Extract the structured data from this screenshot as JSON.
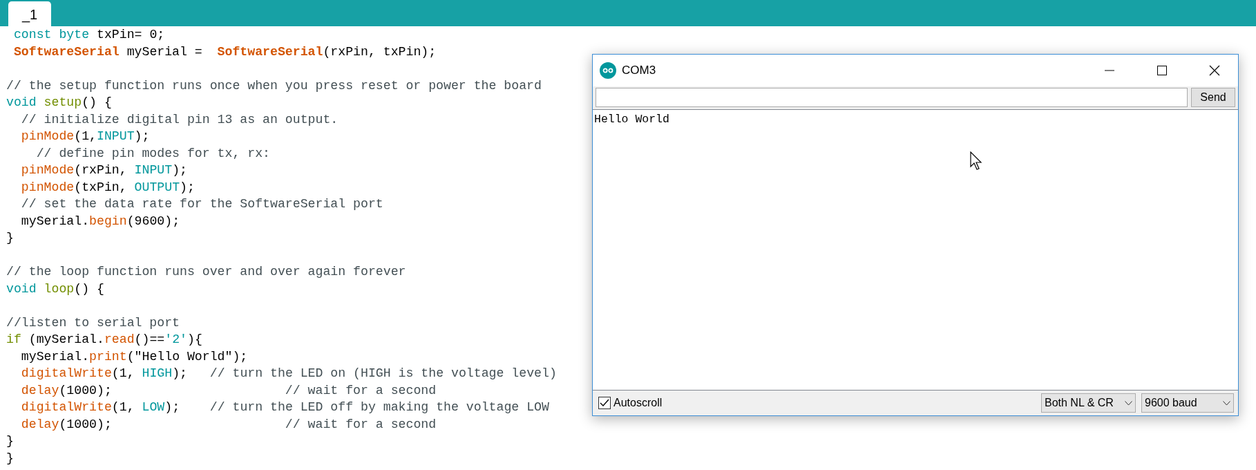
{
  "tabs": [
    {
      "label": "_1",
      "selected": true
    }
  ],
  "code": {
    "lines": [
      {
        "kind": "code",
        "tokens": [
          {
            "kind": "keyword",
            "text": " const"
          },
          {
            "kind": "keyword",
            "text": " byte"
          },
          {
            "kind": "plain",
            "text": " txPin= 0;"
          }
        ]
      },
      {
        "kind": "code",
        "tokens": [
          {
            "kind": "class",
            "text": " SoftwareSerial"
          },
          {
            "kind": "plain",
            "text": " mySerial =  "
          },
          {
            "kind": "class",
            "text": "SoftwareSerial"
          },
          {
            "kind": "plain",
            "text": "(rxPin, txPin);"
          }
        ]
      },
      {
        "kind": "blank"
      },
      {
        "kind": "code",
        "tokens": [
          {
            "kind": "comment",
            "text": "// the setup function runs once when you press reset or power the board"
          }
        ]
      },
      {
        "kind": "code",
        "tokens": [
          {
            "kind": "keyword",
            "text": "void "
          },
          {
            "kind": "control",
            "text": "setup"
          },
          {
            "kind": "plain",
            "text": "() {"
          }
        ]
      },
      {
        "kind": "code",
        "tokens": [
          {
            "kind": "comment",
            "text": "  // initialize digital pin 13 as an output."
          }
        ]
      },
      {
        "kind": "code",
        "tokens": [
          {
            "kind": "function",
            "text": "  pinMode"
          },
          {
            "kind": "plain",
            "text": "(1,"
          },
          {
            "kind": "keyword",
            "text": "INPUT"
          },
          {
            "kind": "plain",
            "text": ");"
          }
        ]
      },
      {
        "kind": "code",
        "tokens": [
          {
            "kind": "comment",
            "text": "    // define pin modes for tx, rx:"
          }
        ]
      },
      {
        "kind": "code",
        "tokens": [
          {
            "kind": "function",
            "text": "  pinMode"
          },
          {
            "kind": "plain",
            "text": "(rxPin, "
          },
          {
            "kind": "keyword",
            "text": "INPUT"
          },
          {
            "kind": "plain",
            "text": ");"
          }
        ]
      },
      {
        "kind": "code",
        "tokens": [
          {
            "kind": "function",
            "text": "  pinMode"
          },
          {
            "kind": "plain",
            "text": "(txPin, "
          },
          {
            "kind": "keyword",
            "text": "OUTPUT"
          },
          {
            "kind": "plain",
            "text": ");"
          }
        ]
      },
      {
        "kind": "code",
        "tokens": [
          {
            "kind": "comment",
            "text": "  // set the data rate for the SoftwareSerial port"
          }
        ]
      },
      {
        "kind": "code",
        "tokens": [
          {
            "kind": "plain",
            "text": "  mySerial."
          },
          {
            "kind": "function",
            "text": "begin"
          },
          {
            "kind": "plain",
            "text": "(9600);"
          }
        ]
      },
      {
        "kind": "code",
        "tokens": [
          {
            "kind": "plain",
            "text": "}"
          }
        ]
      },
      {
        "kind": "blank"
      },
      {
        "kind": "code",
        "tokens": [
          {
            "kind": "comment",
            "text": "// the loop function runs over and over again forever"
          }
        ]
      },
      {
        "kind": "code",
        "tokens": [
          {
            "kind": "keyword",
            "text": "void "
          },
          {
            "kind": "control",
            "text": "loop"
          },
          {
            "kind": "plain",
            "text": "() {"
          }
        ]
      },
      {
        "kind": "blank"
      },
      {
        "kind": "code",
        "tokens": [
          {
            "kind": "comment",
            "text": "//listen to serial port"
          }
        ]
      },
      {
        "kind": "code",
        "tokens": [
          {
            "kind": "control",
            "text": "if"
          },
          {
            "kind": "plain",
            "text": " (mySerial."
          },
          {
            "kind": "function",
            "text": "read"
          },
          {
            "kind": "plain",
            "text": "()=="
          },
          {
            "kind": "keyword",
            "text": "'2'"
          },
          {
            "kind": "plain",
            "text": "){"
          }
        ]
      },
      {
        "kind": "code",
        "tokens": [
          {
            "kind": "plain",
            "text": "  mySerial."
          },
          {
            "kind": "function",
            "text": "print"
          },
          {
            "kind": "plain",
            "text": "(\"Hello World\");"
          }
        ]
      },
      {
        "kind": "code",
        "tokens": [
          {
            "kind": "function",
            "text": "  digitalWrite"
          },
          {
            "kind": "plain",
            "text": "(1, "
          },
          {
            "kind": "keyword",
            "text": "HIGH"
          },
          {
            "kind": "plain",
            "text": ");   "
          },
          {
            "kind": "comment",
            "text": "// turn the LED on (HIGH is the voltage level)"
          }
        ]
      },
      {
        "kind": "code",
        "tokens": [
          {
            "kind": "function",
            "text": "  delay"
          },
          {
            "kind": "plain",
            "text": "(1000);                       "
          },
          {
            "kind": "comment",
            "text": "// wait for a second"
          }
        ]
      },
      {
        "kind": "code",
        "tokens": [
          {
            "kind": "function",
            "text": "  digitalWrite"
          },
          {
            "kind": "plain",
            "text": "(1, "
          },
          {
            "kind": "keyword",
            "text": "LOW"
          },
          {
            "kind": "plain",
            "text": ");    "
          },
          {
            "kind": "comment",
            "text": "// turn the LED off by making the voltage LOW"
          }
        ]
      },
      {
        "kind": "code",
        "tokens": [
          {
            "kind": "function",
            "text": "  delay"
          },
          {
            "kind": "plain",
            "text": "(1000);                       "
          },
          {
            "kind": "comment",
            "text": "// wait for a second"
          }
        ]
      },
      {
        "kind": "code",
        "tokens": [
          {
            "kind": "plain",
            "text": "}"
          }
        ]
      },
      {
        "kind": "code",
        "tokens": [
          {
            "kind": "plain",
            "text": "}"
          }
        ]
      }
    ]
  },
  "serial_monitor": {
    "title": "COM3",
    "send_button": "Send",
    "output": [
      "Hello World"
    ],
    "autoscroll": {
      "label": "Autoscroll",
      "checked": true
    },
    "line_ending": "Both NL & CR",
    "baud_rate": "9600 baud"
  }
}
